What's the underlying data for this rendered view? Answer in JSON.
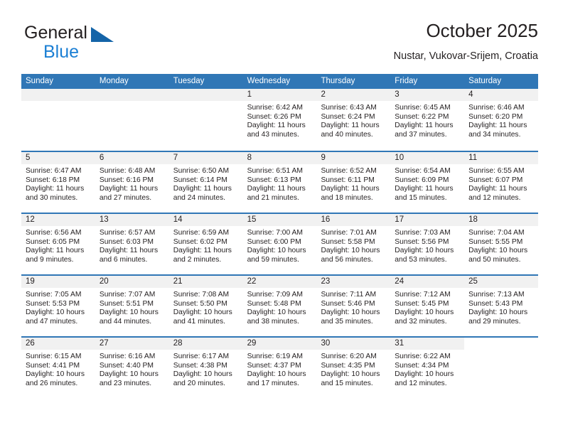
{
  "brand": {
    "name_part1": "General",
    "name_part2": "Blue",
    "triangle_color": "#1464a8",
    "blue_text_color": "#1b7fd4"
  },
  "header": {
    "title": "October 2025",
    "subtitle": "Nustar, Vukovar-Srijem, Croatia"
  },
  "theme": {
    "header_blue": "#3077b6",
    "daynum_band": "#f1f1f1",
    "text": "#231f20"
  },
  "weekdays": [
    "Sunday",
    "Monday",
    "Tuesday",
    "Wednesday",
    "Thursday",
    "Friday",
    "Saturday"
  ],
  "weeks": [
    [
      {
        "day": "",
        "empty": true
      },
      {
        "day": "",
        "empty": true
      },
      {
        "day": "",
        "empty": true
      },
      {
        "day": "1",
        "sunrise": "Sunrise: 6:42 AM",
        "sunset": "Sunset: 6:26 PM",
        "daylight1": "Daylight: 11 hours",
        "daylight2": "and 43 minutes."
      },
      {
        "day": "2",
        "sunrise": "Sunrise: 6:43 AM",
        "sunset": "Sunset: 6:24 PM",
        "daylight1": "Daylight: 11 hours",
        "daylight2": "and 40 minutes."
      },
      {
        "day": "3",
        "sunrise": "Sunrise: 6:45 AM",
        "sunset": "Sunset: 6:22 PM",
        "daylight1": "Daylight: 11 hours",
        "daylight2": "and 37 minutes."
      },
      {
        "day": "4",
        "sunrise": "Sunrise: 6:46 AM",
        "sunset": "Sunset: 6:20 PM",
        "daylight1": "Daylight: 11 hours",
        "daylight2": "and 34 minutes."
      }
    ],
    [
      {
        "day": "5",
        "sunrise": "Sunrise: 6:47 AM",
        "sunset": "Sunset: 6:18 PM",
        "daylight1": "Daylight: 11 hours",
        "daylight2": "and 30 minutes."
      },
      {
        "day": "6",
        "sunrise": "Sunrise: 6:48 AM",
        "sunset": "Sunset: 6:16 PM",
        "daylight1": "Daylight: 11 hours",
        "daylight2": "and 27 minutes."
      },
      {
        "day": "7",
        "sunrise": "Sunrise: 6:50 AM",
        "sunset": "Sunset: 6:14 PM",
        "daylight1": "Daylight: 11 hours",
        "daylight2": "and 24 minutes."
      },
      {
        "day": "8",
        "sunrise": "Sunrise: 6:51 AM",
        "sunset": "Sunset: 6:13 PM",
        "daylight1": "Daylight: 11 hours",
        "daylight2": "and 21 minutes."
      },
      {
        "day": "9",
        "sunrise": "Sunrise: 6:52 AM",
        "sunset": "Sunset: 6:11 PM",
        "daylight1": "Daylight: 11 hours",
        "daylight2": "and 18 minutes."
      },
      {
        "day": "10",
        "sunrise": "Sunrise: 6:54 AM",
        "sunset": "Sunset: 6:09 PM",
        "daylight1": "Daylight: 11 hours",
        "daylight2": "and 15 minutes."
      },
      {
        "day": "11",
        "sunrise": "Sunrise: 6:55 AM",
        "sunset": "Sunset: 6:07 PM",
        "daylight1": "Daylight: 11 hours",
        "daylight2": "and 12 minutes."
      }
    ],
    [
      {
        "day": "12",
        "sunrise": "Sunrise: 6:56 AM",
        "sunset": "Sunset: 6:05 PM",
        "daylight1": "Daylight: 11 hours",
        "daylight2": "and 9 minutes."
      },
      {
        "day": "13",
        "sunrise": "Sunrise: 6:57 AM",
        "sunset": "Sunset: 6:03 PM",
        "daylight1": "Daylight: 11 hours",
        "daylight2": "and 6 minutes."
      },
      {
        "day": "14",
        "sunrise": "Sunrise: 6:59 AM",
        "sunset": "Sunset: 6:02 PM",
        "daylight1": "Daylight: 11 hours",
        "daylight2": "and 2 minutes."
      },
      {
        "day": "15",
        "sunrise": "Sunrise: 7:00 AM",
        "sunset": "Sunset: 6:00 PM",
        "daylight1": "Daylight: 10 hours",
        "daylight2": "and 59 minutes."
      },
      {
        "day": "16",
        "sunrise": "Sunrise: 7:01 AM",
        "sunset": "Sunset: 5:58 PM",
        "daylight1": "Daylight: 10 hours",
        "daylight2": "and 56 minutes."
      },
      {
        "day": "17",
        "sunrise": "Sunrise: 7:03 AM",
        "sunset": "Sunset: 5:56 PM",
        "daylight1": "Daylight: 10 hours",
        "daylight2": "and 53 minutes."
      },
      {
        "day": "18",
        "sunrise": "Sunrise: 7:04 AM",
        "sunset": "Sunset: 5:55 PM",
        "daylight1": "Daylight: 10 hours",
        "daylight2": "and 50 minutes."
      }
    ],
    [
      {
        "day": "19",
        "sunrise": "Sunrise: 7:05 AM",
        "sunset": "Sunset: 5:53 PM",
        "daylight1": "Daylight: 10 hours",
        "daylight2": "and 47 minutes."
      },
      {
        "day": "20",
        "sunrise": "Sunrise: 7:07 AM",
        "sunset": "Sunset: 5:51 PM",
        "daylight1": "Daylight: 10 hours",
        "daylight2": "and 44 minutes."
      },
      {
        "day": "21",
        "sunrise": "Sunrise: 7:08 AM",
        "sunset": "Sunset: 5:50 PM",
        "daylight1": "Daylight: 10 hours",
        "daylight2": "and 41 minutes."
      },
      {
        "day": "22",
        "sunrise": "Sunrise: 7:09 AM",
        "sunset": "Sunset: 5:48 PM",
        "daylight1": "Daylight: 10 hours",
        "daylight2": "and 38 minutes."
      },
      {
        "day": "23",
        "sunrise": "Sunrise: 7:11 AM",
        "sunset": "Sunset: 5:46 PM",
        "daylight1": "Daylight: 10 hours",
        "daylight2": "and 35 minutes."
      },
      {
        "day": "24",
        "sunrise": "Sunrise: 7:12 AM",
        "sunset": "Sunset: 5:45 PM",
        "daylight1": "Daylight: 10 hours",
        "daylight2": "and 32 minutes."
      },
      {
        "day": "25",
        "sunrise": "Sunrise: 7:13 AM",
        "sunset": "Sunset: 5:43 PM",
        "daylight1": "Daylight: 10 hours",
        "daylight2": "and 29 minutes."
      }
    ],
    [
      {
        "day": "26",
        "sunrise": "Sunrise: 6:15 AM",
        "sunset": "Sunset: 4:41 PM",
        "daylight1": "Daylight: 10 hours",
        "daylight2": "and 26 minutes."
      },
      {
        "day": "27",
        "sunrise": "Sunrise: 6:16 AM",
        "sunset": "Sunset: 4:40 PM",
        "daylight1": "Daylight: 10 hours",
        "daylight2": "and 23 minutes."
      },
      {
        "day": "28",
        "sunrise": "Sunrise: 6:17 AM",
        "sunset": "Sunset: 4:38 PM",
        "daylight1": "Daylight: 10 hours",
        "daylight2": "and 20 minutes."
      },
      {
        "day": "29",
        "sunrise": "Sunrise: 6:19 AM",
        "sunset": "Sunset: 4:37 PM",
        "daylight1": "Daylight: 10 hours",
        "daylight2": "and 17 minutes."
      },
      {
        "day": "30",
        "sunrise": "Sunrise: 6:20 AM",
        "sunset": "Sunset: 4:35 PM",
        "daylight1": "Daylight: 10 hours",
        "daylight2": "and 15 minutes."
      },
      {
        "day": "31",
        "sunrise": "Sunrise: 6:22 AM",
        "sunset": "Sunset: 4:34 PM",
        "daylight1": "Daylight: 10 hours",
        "daylight2": "and 12 minutes."
      },
      {
        "day": "",
        "empty": true,
        "blank": true
      }
    ]
  ]
}
